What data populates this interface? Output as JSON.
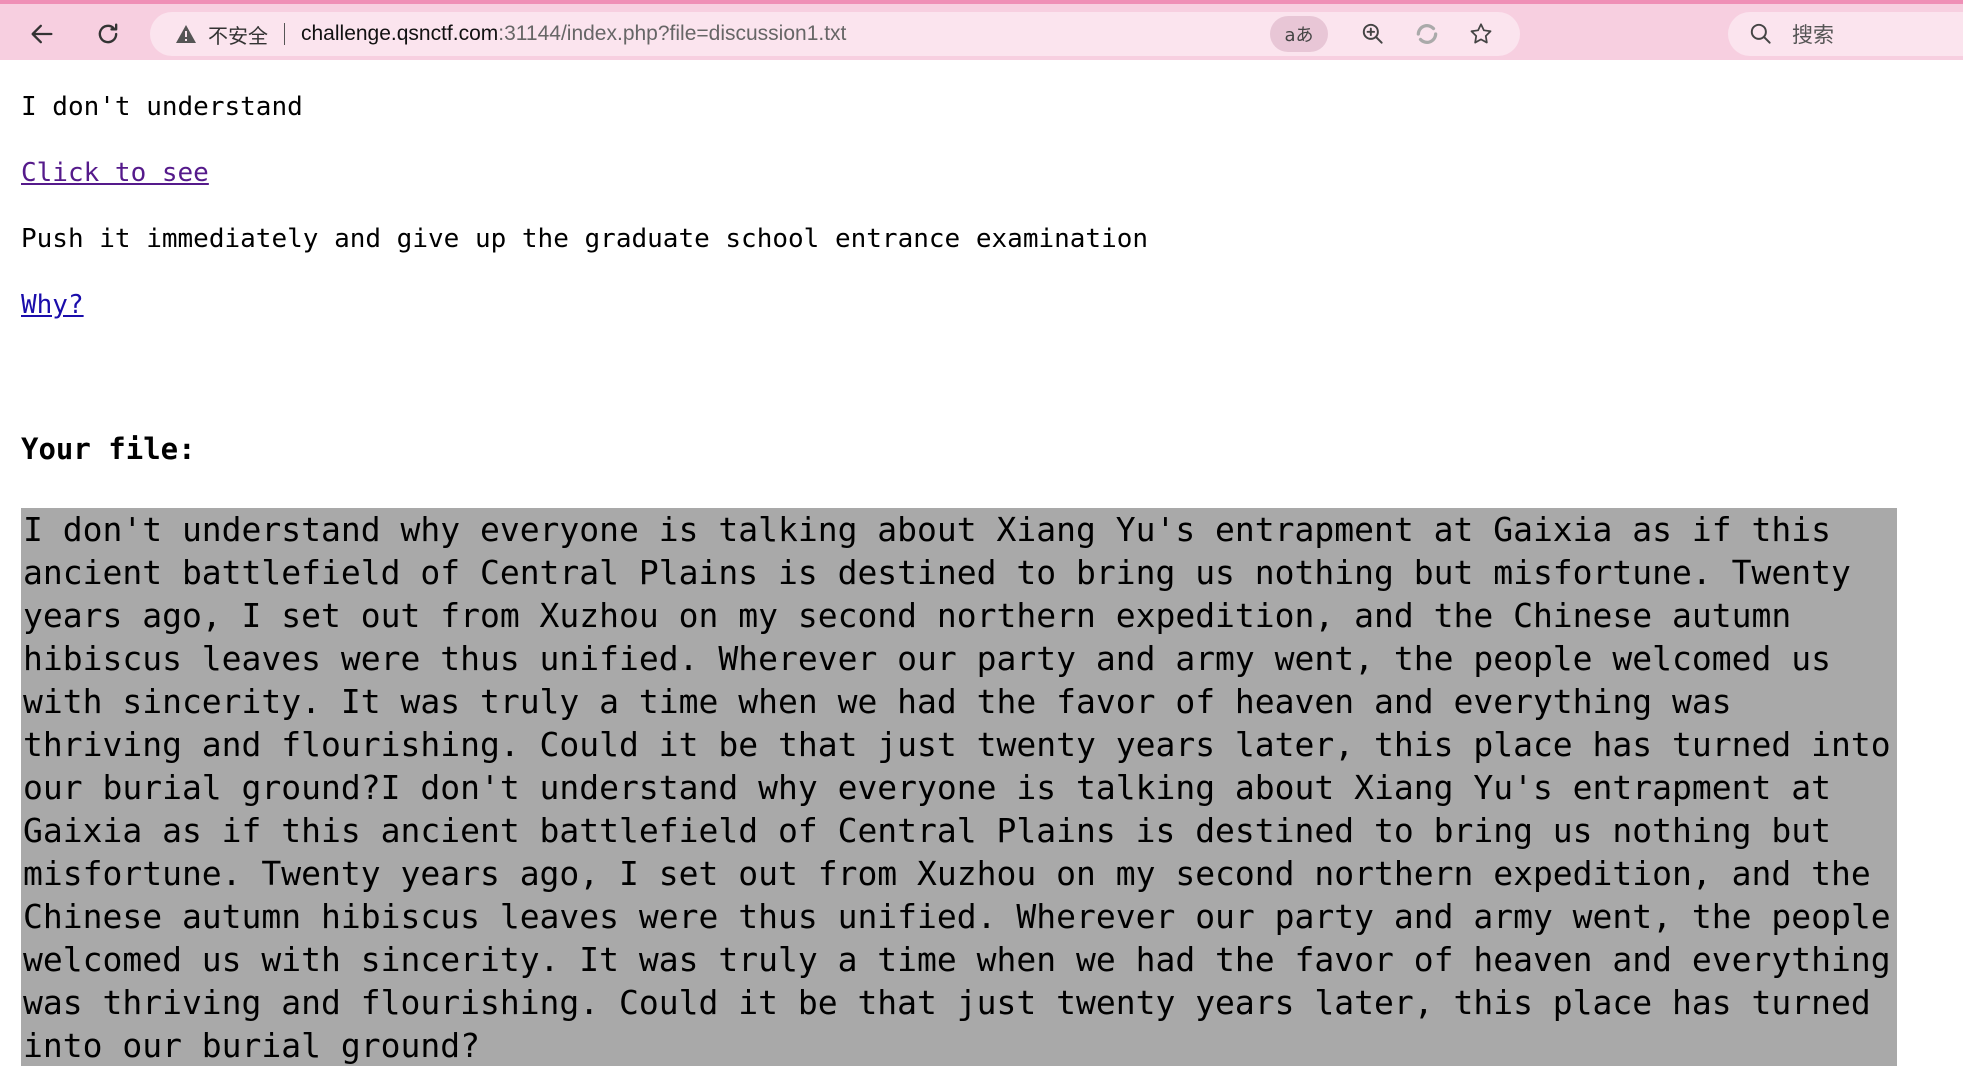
{
  "browser": {
    "security_label": "不安全",
    "url_host": "challenge.qsnctf.com",
    "url_rest": ":31144/index.php?file=discussion1.txt",
    "read_aloud_label": "aあ",
    "search_placeholder": "搜索",
    "icons": [
      "back-arrow-icon",
      "reload-icon",
      "warning-icon",
      "zoom-in-icon",
      "refresh-sync-icon",
      "star-icon",
      "search-icon"
    ]
  },
  "page": {
    "line1": "I don't understand",
    "link1": "Click to see",
    "line2": "Push it immediately and give up the graduate school entrance examination",
    "link2": "Why?",
    "heading": "Your file:",
    "file_content": "I don't understand why everyone is talking about Xiang Yu's entrapment at Gaixia as if this ancient battlefield of Central Plains is destined to bring us nothing but misfortune. Twenty years ago, I set out from Xuzhou on my second northern expedition, and the Chinese autumn hibiscus leaves were thus unified. Wherever our party and army went, the people welcomed us with sincerity. It was truly a time when we had the favor of heaven and everything was thriving and flourishing. Could it be that just twenty years later, this place has turned into our burial ground?I don't understand why everyone is talking about Xiang Yu's entrapment at Gaixia as if this ancient battlefield of Central Plains is destined to bring us nothing but misfortune. Twenty years ago, I set out from Xuzhou on my second northern expedition, and the Chinese autumn hibiscus leaves were thus unified. Wherever our party and army went, the people welcomed us with sincerity. It was truly a time when we had the favor of heaven and everything was thriving and flourishing. Could it be that just twenty years later, this place has turned into our burial ground?"
  },
  "colors": {
    "toolbar": "#f7cfe0",
    "selection": "#a9a9a9",
    "link": "#1a0dab",
    "visited_link": "#551a8b"
  }
}
